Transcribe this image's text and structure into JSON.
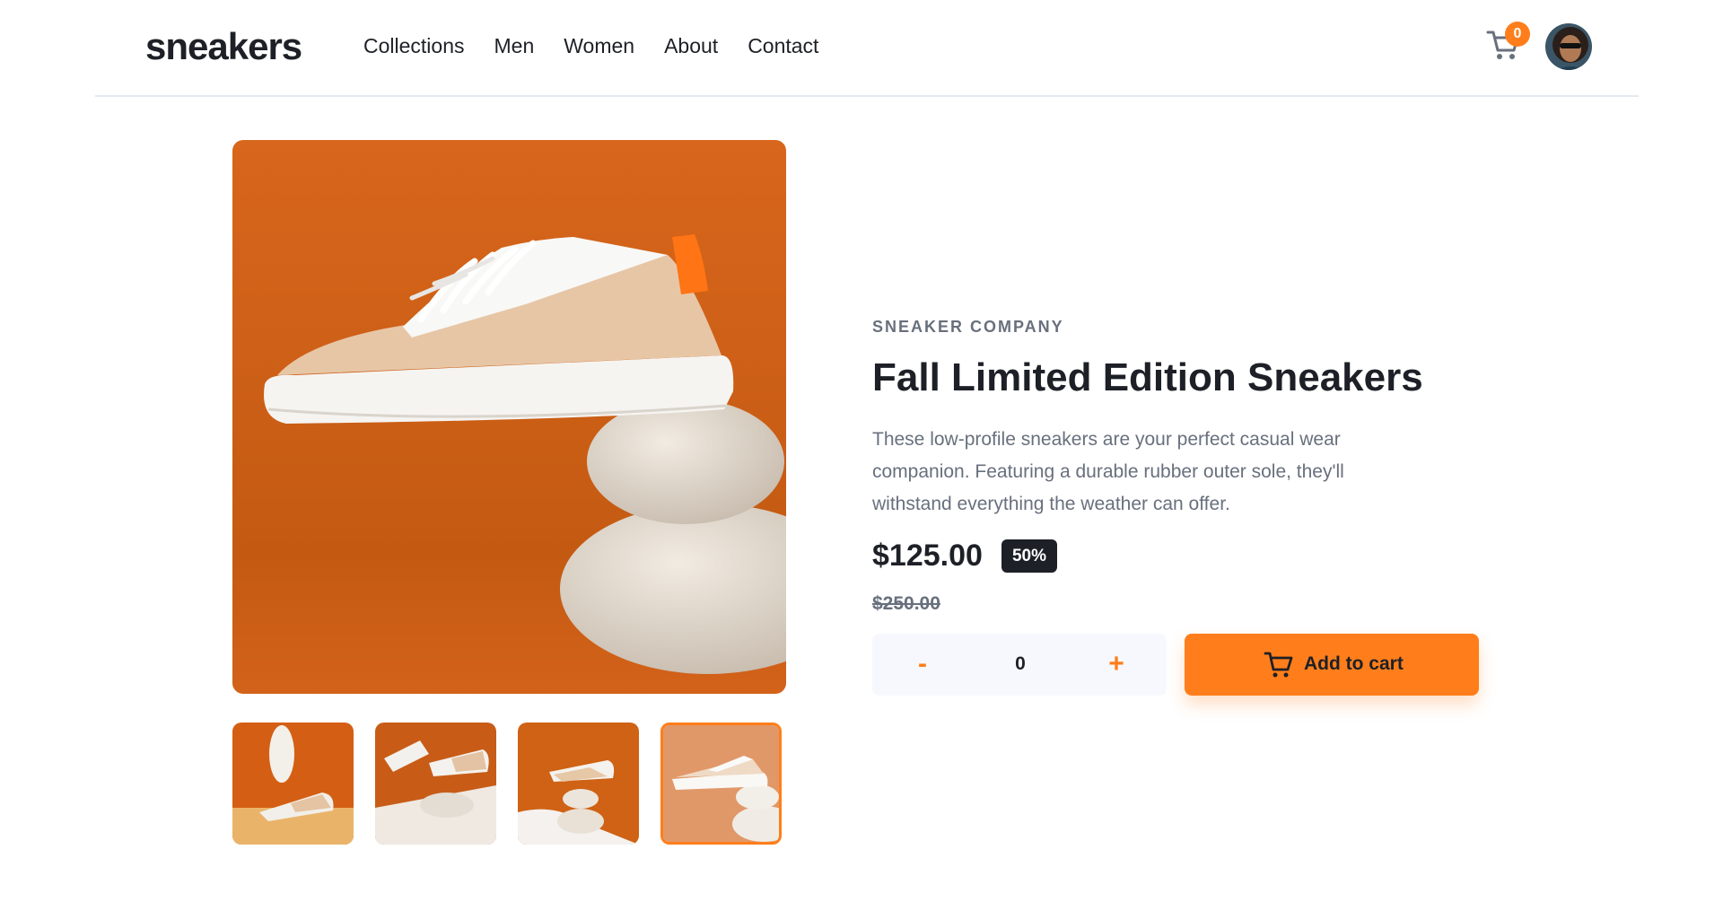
{
  "header": {
    "logo": "sneakers",
    "nav": [
      "Collections",
      "Men",
      "Women",
      "About",
      "Contact"
    ],
    "cart_count": "0",
    "cart_icon": "cart-icon",
    "avatar": "user-avatar"
  },
  "gallery": {
    "active_thumbnail": 4,
    "thumbnails": [
      "product-thumbnail-1",
      "product-thumbnail-2",
      "product-thumbnail-3",
      "product-thumbnail-4"
    ]
  },
  "product": {
    "company": "SNEAKER COMPANY",
    "title": "Fall Limited Edition Sneakers",
    "description": "These low-profile sneakers are your perfect casual wear companion. Featuring a durable rubber outer sole, they'll withstand everything the weather can offer.",
    "price": "$125.00",
    "discount": "50%",
    "original_price": "$250.00"
  },
  "quantity": {
    "minus_label": "-",
    "value": "0",
    "plus_label": "+"
  },
  "add_to_cart": {
    "label": "Add to cart"
  },
  "colors": {
    "accent": "#ff7e1b",
    "dark": "#1d2026",
    "muted": "#68707d",
    "image_background": "#d35f12"
  }
}
